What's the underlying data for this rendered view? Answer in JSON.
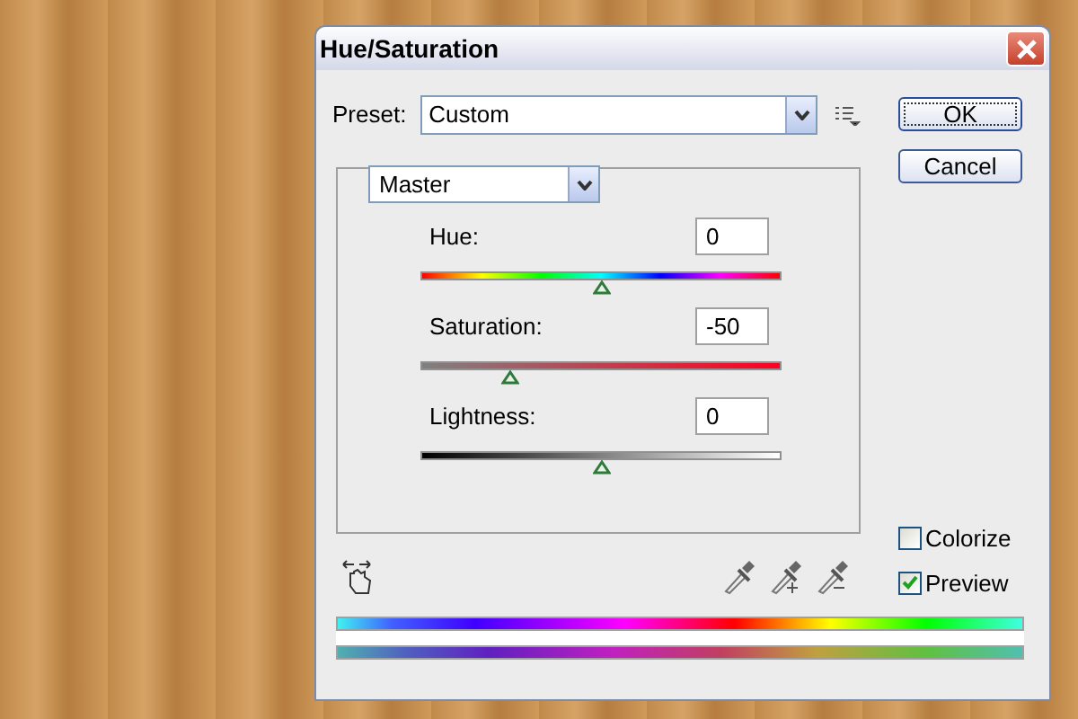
{
  "window": {
    "title": "Hue/Saturation"
  },
  "preset": {
    "label": "Preset:",
    "value": "Custom"
  },
  "buttons": [
    {
      "label": "OK",
      "default": true
    },
    {
      "label": "Cancel",
      "default": false
    }
  ],
  "channel": {
    "value": "Master"
  },
  "sliders": [
    {
      "kind": "hue",
      "label": "Hue:",
      "value": "0",
      "level": 0.5
    },
    {
      "kind": "saturation",
      "label": "Saturation:",
      "value": "-50",
      "level": 0.25
    },
    {
      "kind": "lightness",
      "label": "Lightness:",
      "value": "0",
      "level": 0.5
    }
  ],
  "checkboxes": [
    {
      "label": "Colorize",
      "checked": false
    },
    {
      "label": "Preview",
      "checked": true
    }
  ]
}
